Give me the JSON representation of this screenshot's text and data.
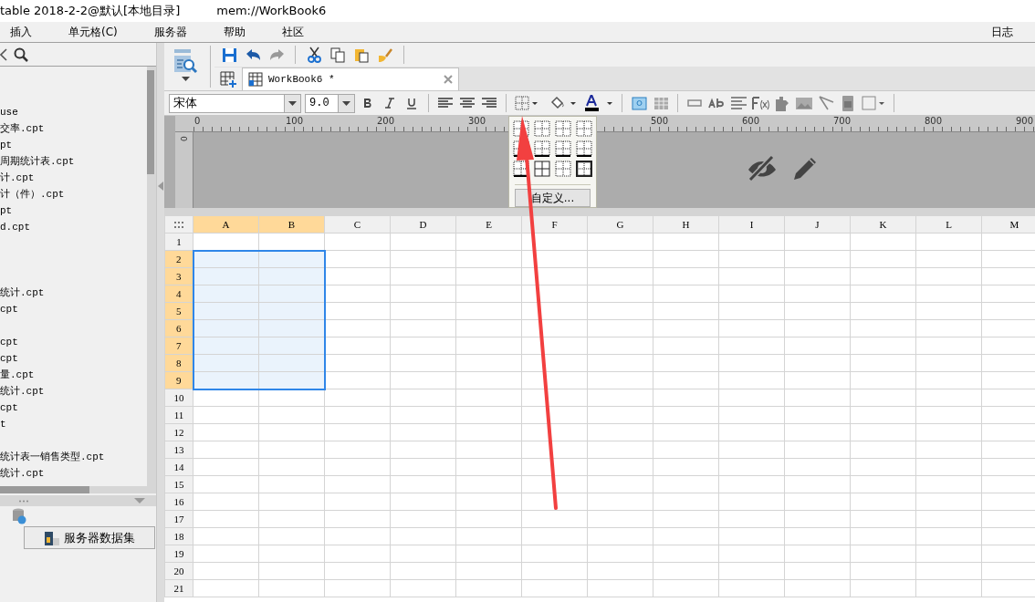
{
  "window": {
    "title": "table 2018-2-2@默认[本地目录]",
    "path": "mem://WorkBook6"
  },
  "menu": [
    {
      "label": "插入"
    },
    {
      "label": "单元格(C)"
    },
    {
      "label": "服务器"
    },
    {
      "label": "帮助"
    },
    {
      "label": "社区"
    }
  ],
  "menu_right": {
    "label": "日志"
  },
  "file_tree": {
    "items": [
      {
        "kind": "file",
        "label": "use"
      },
      {
        "kind": "file",
        "label": "交率.cpt"
      },
      {
        "kind": "file",
        "label": "pt"
      },
      {
        "kind": "file",
        "label": "周期统计表.cpt"
      },
      {
        "kind": "file",
        "label": "计.cpt"
      },
      {
        "kind": "file",
        "label": "计（件）.cpt"
      },
      {
        "kind": "file",
        "label": "pt"
      },
      {
        "kind": "file",
        "label": "d.cpt"
      },
      {
        "kind": "folder"
      },
      {
        "kind": "folder"
      },
      {
        "kind": "folder"
      },
      {
        "kind": "file",
        "label": "统计.cpt"
      },
      {
        "kind": "file",
        "label": "cpt"
      },
      {
        "kind": "folder"
      },
      {
        "kind": "file",
        "label": "cpt"
      },
      {
        "kind": "file",
        "label": "cpt"
      },
      {
        "kind": "file",
        "label": "量.cpt"
      },
      {
        "kind": "file",
        "label": "统计.cpt"
      },
      {
        "kind": "file",
        "label": "cpt"
      },
      {
        "kind": "file",
        "label": "t"
      },
      {
        "kind": "folder"
      },
      {
        "kind": "file",
        "label": "统计表一销售类型.cpt"
      },
      {
        "kind": "file",
        "label": "统计.cpt"
      }
    ]
  },
  "server_dataset_tab": {
    "label": "服务器数据集"
  },
  "tabs": [
    {
      "label": "WorkBook6 *",
      "selected": true
    }
  ],
  "format_bar": {
    "font": "宋体",
    "size": "9.0"
  },
  "border_menu": {
    "custom_button": "自定义..."
  },
  "ruler": {
    "x_labels": [
      "0",
      "100",
      "200",
      "300",
      "500",
      "600",
      "700",
      "800",
      "900"
    ],
    "y_labels": [
      "0"
    ]
  },
  "sheet": {
    "columns": [
      {
        "label": "A",
        "selected": true
      },
      {
        "label": "B",
        "selected": true
      },
      {
        "label": "C",
        "selected": false
      },
      {
        "label": "D",
        "selected": false
      },
      {
        "label": "E",
        "selected": false
      },
      {
        "label": "F",
        "selected": false
      },
      {
        "label": "G",
        "selected": false
      },
      {
        "label": "H",
        "selected": false
      },
      {
        "label": "I",
        "selected": false
      },
      {
        "label": "J",
        "selected": false
      },
      {
        "label": "K",
        "selected": false
      },
      {
        "label": "L",
        "selected": false
      },
      {
        "label": "M",
        "selected": false
      }
    ],
    "rows": [
      {
        "label": "1",
        "selected": false
      },
      {
        "label": "2",
        "selected": true
      },
      {
        "label": "3",
        "selected": true
      },
      {
        "label": "4",
        "selected": true
      },
      {
        "label": "5",
        "selected": true
      },
      {
        "label": "6",
        "selected": true
      },
      {
        "label": "7",
        "selected": true
      },
      {
        "label": "8",
        "selected": true
      },
      {
        "label": "9",
        "selected": true
      },
      {
        "label": "10",
        "selected": false
      },
      {
        "label": "11",
        "selected": false
      },
      {
        "label": "12",
        "selected": false
      },
      {
        "label": "13",
        "selected": false
      },
      {
        "label": "14",
        "selected": false
      },
      {
        "label": "15",
        "selected": false
      },
      {
        "label": "16",
        "selected": false
      },
      {
        "label": "17",
        "selected": false
      },
      {
        "label": "18",
        "selected": false
      },
      {
        "label": "19",
        "selected": false
      },
      {
        "label": "20",
        "selected": false
      },
      {
        "label": "21",
        "selected": false
      }
    ]
  }
}
